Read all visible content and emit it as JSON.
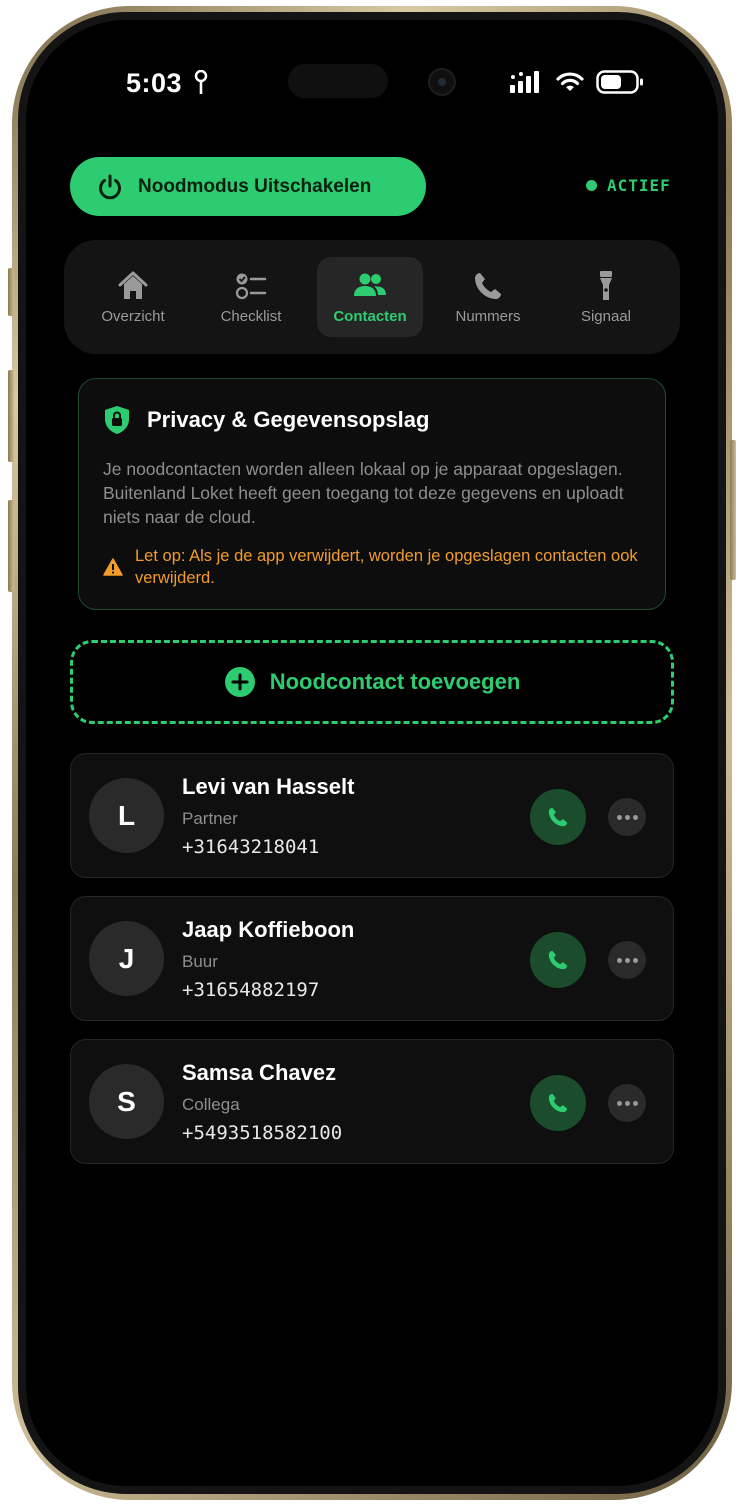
{
  "status_bar": {
    "time": "5:03"
  },
  "header": {
    "emergency_button_label": "Noodmodus Uitschakelen",
    "status_label": "ACTIEF"
  },
  "tabs": [
    {
      "label": "Overzicht",
      "icon": "home-icon",
      "active": false
    },
    {
      "label": "Checklist",
      "icon": "checklist-icon",
      "active": false
    },
    {
      "label": "Contacten",
      "icon": "people-icon",
      "active": true
    },
    {
      "label": "Nummers",
      "icon": "phone-icon",
      "active": false
    },
    {
      "label": "Signaal",
      "icon": "flashlight-icon",
      "active": false
    }
  ],
  "privacy": {
    "title": "Privacy & Gegevensopslag",
    "body": "Je noodcontacten worden alleen lokaal op je apparaat opgeslagen. Buitenland Loket heeft geen toegang tot deze gegevens en uploadt niets naar de cloud.",
    "warning": "Let op: Als je de app verwijdert, worden je opgeslagen contacten ook verwijderd."
  },
  "add_contact_label": "Noodcontact toevoegen",
  "contacts": [
    {
      "initial": "L",
      "name": "Levi van Hasselt",
      "relation": "Partner",
      "phone": "+31643218041"
    },
    {
      "initial": "J",
      "name": "Jaap Koffieboon",
      "relation": "Buur",
      "phone": "+31654882197"
    },
    {
      "initial": "S",
      "name": "Samsa Chavez",
      "relation": "Collega",
      "phone": "+5493518582100"
    }
  ],
  "colors": {
    "accent": "#2ecc71",
    "warning": "#f39c2a",
    "background": "#000000",
    "card": "#0f0f0f"
  }
}
